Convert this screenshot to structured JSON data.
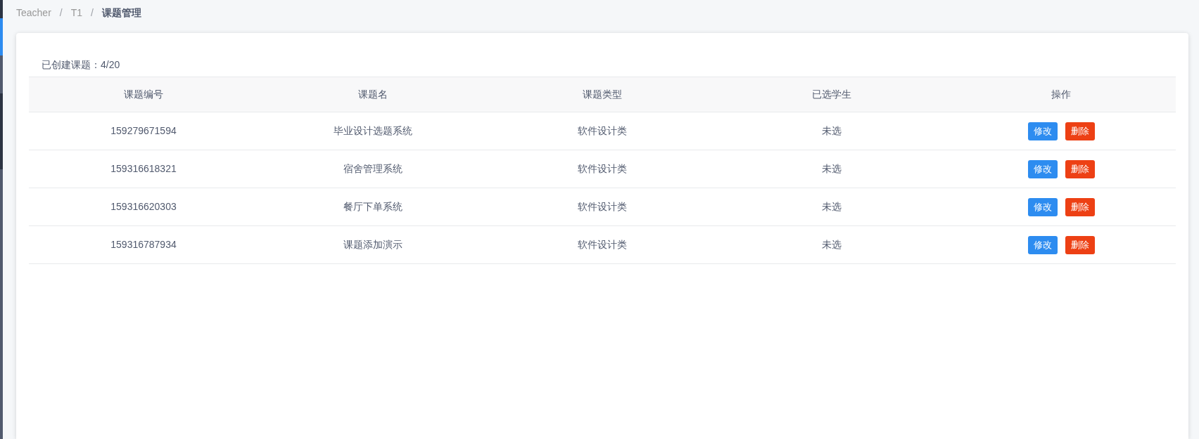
{
  "breadcrumb": [
    {
      "label": "Teacher",
      "selected": false
    },
    {
      "label": "T1",
      "selected": false
    },
    {
      "label": "课题管理",
      "selected": true
    }
  ],
  "breadcrumb_separator": "/",
  "summary": {
    "label": "已创建课题：",
    "value": "4/20"
  },
  "table": {
    "columns": [
      "课题编号",
      "课题名",
      "课题类型",
      "已选学生",
      "操作"
    ],
    "rows": [
      {
        "id": "159279671594",
        "name": "毕业设计选题系统",
        "type": "软件设计类",
        "student": "未选",
        "actions": [
          {
            "label": "修改",
            "kind": "edit"
          },
          {
            "label": "删除",
            "kind": "delete"
          }
        ]
      },
      {
        "id": "159316618321",
        "name": "宿舍管理系统",
        "type": "软件设计类",
        "student": "未选",
        "actions": [
          {
            "label": "修改",
            "kind": "edit"
          },
          {
            "label": "删除",
            "kind": "delete"
          }
        ]
      },
      {
        "id": "159316620303",
        "name": "餐厅下单系统",
        "type": "软件设计类",
        "student": "未选",
        "actions": [
          {
            "label": "修改",
            "kind": "edit"
          },
          {
            "label": "删除",
            "kind": "delete"
          }
        ]
      },
      {
        "id": "159316787934",
        "name": "课题添加演示",
        "type": "软件设计类",
        "student": "未选",
        "actions": [
          {
            "label": "修改",
            "kind": "edit"
          },
          {
            "label": "删除",
            "kind": "delete"
          }
        ]
      }
    ]
  }
}
